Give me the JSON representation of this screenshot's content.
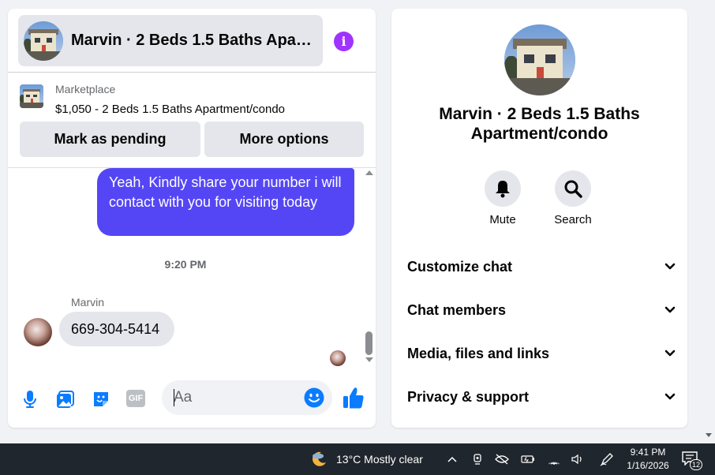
{
  "chat": {
    "title": "Marvin · 2 Beds 1.5 Baths Apar…",
    "marketplace_label": "Marketplace",
    "listing_price_title": "$1,050 - 2 Beds 1.5 Baths Apartment/condo",
    "mark_pending_label": "Mark as pending",
    "more_options_label": "More options",
    "messages": {
      "outgoing_text": "Yeah, Kindly share your number i will contact with you for visiting today",
      "timestamp": "9:20 PM",
      "sender_name": "Marvin",
      "incoming_text": "669-304-5414"
    },
    "composer": {
      "placeholder": "Aa",
      "gif_label": "GIF"
    }
  },
  "details": {
    "title": "Marvin · 2 Beds 1.5 Baths Apartment/condo",
    "mute_label": "Mute",
    "search_label": "Search",
    "sections": [
      {
        "label": "Customize chat"
      },
      {
        "label": "Chat members"
      },
      {
        "label": "Media, files and links"
      },
      {
        "label": "Privacy & support"
      }
    ]
  },
  "taskbar": {
    "weather": "13°C  Mostly clear",
    "time": "9:41 PM",
    "date": "1/16/2026",
    "notification_count": "12"
  },
  "colors": {
    "accent_purple": "#a033ff",
    "outgoing_bubble": "#5546f5",
    "messenger_blue": "#0a7cff",
    "taskbar_bg": "#20262d"
  },
  "icons": [
    "info-icon",
    "microphone-icon",
    "photo-icon",
    "sticker-icon",
    "gif-icon",
    "emoji-icon",
    "thumbs-up-icon",
    "bell-icon",
    "search-icon",
    "chevron-down-icon"
  ]
}
